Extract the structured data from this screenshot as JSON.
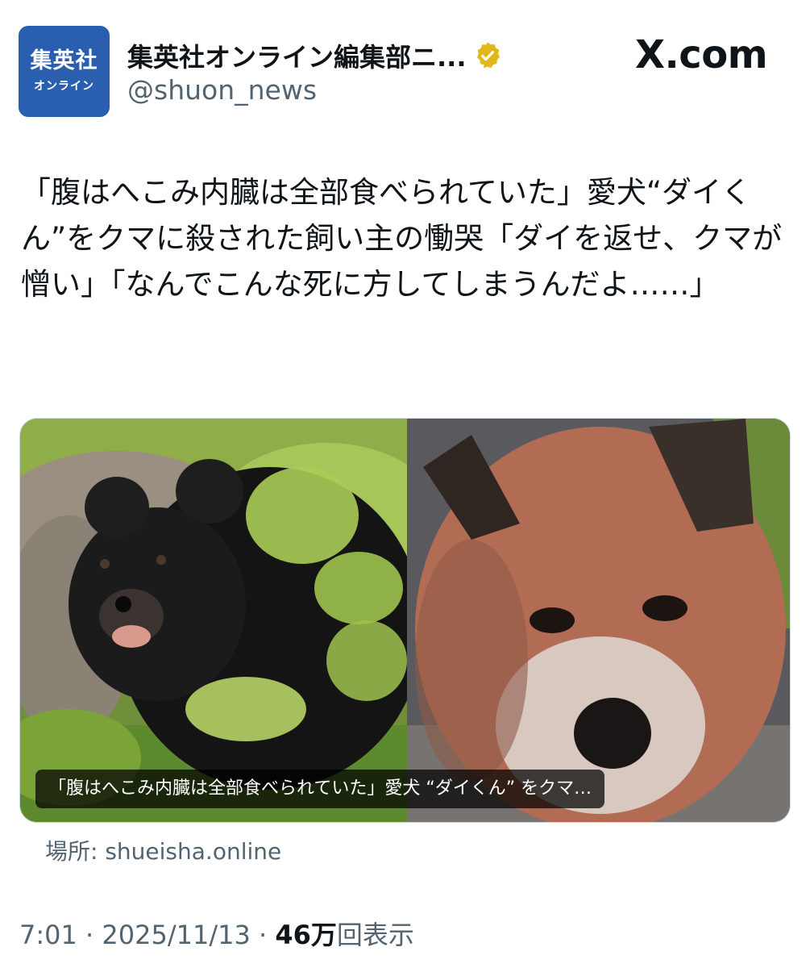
{
  "account": {
    "avatar_line1": "集英社",
    "avatar_line2": "オンライン",
    "display_name": "集英社オンライン編集部ニ...",
    "handle": "@shuon_news",
    "verified_icon": "gold-verified-badge",
    "verified_color": "#e2b719"
  },
  "site_label": "X.com",
  "tweet_text": "「腹はへこみ内臓は全部食べられていた」愛犬“ダイくん”をクマに殺された飼い主の慟哭「ダイを返せ、クマが憎い」「なんでこんな死に方してしまうんだよ……」",
  "media": {
    "left_image": "black bear in foliage",
    "right_image": "shiba-like dog close-up",
    "caption": "「腹はへこみ内臓は全部食べられていた」愛犬 “ダイくん” をクマ…"
  },
  "source": {
    "label": "場所: ",
    "domain": "shueisha.online"
  },
  "meta": {
    "time": "7:01",
    "sep1": " · ",
    "date": "2025/11/13",
    "sep2": " · ",
    "views_count": "46万",
    "views_label": "回表示"
  }
}
